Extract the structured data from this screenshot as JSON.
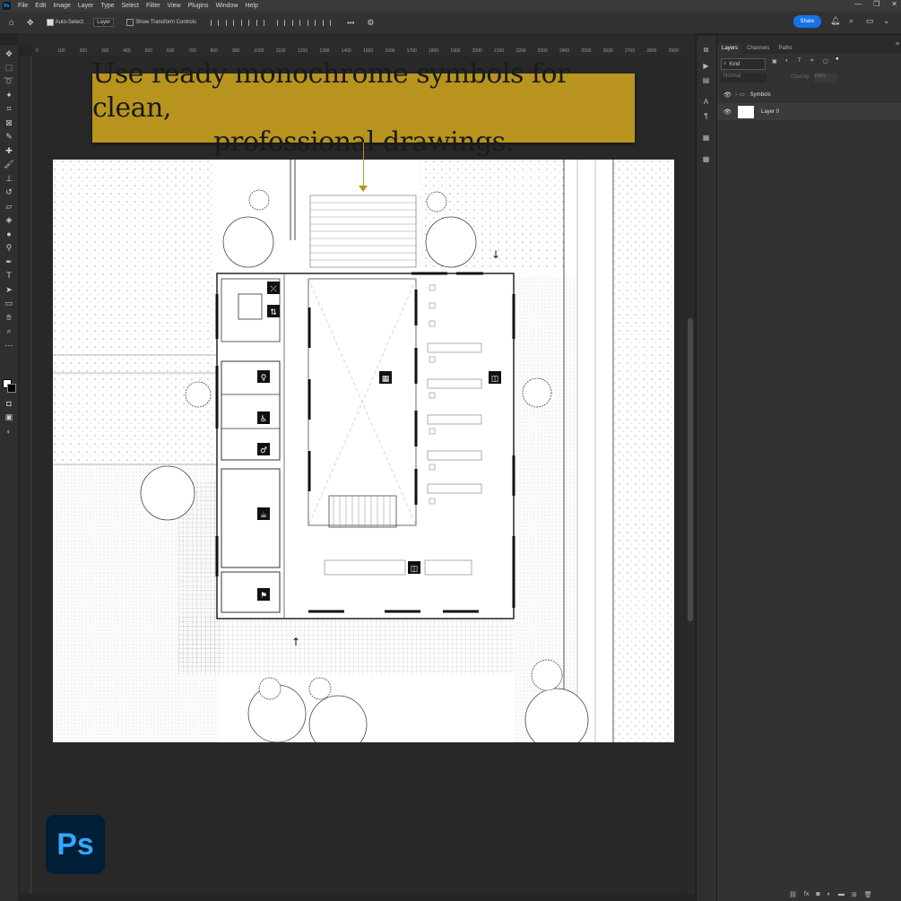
{
  "app": {
    "logo_text": "Ps",
    "mini_logo": "Ps"
  },
  "menu": [
    "File",
    "Edit",
    "Image",
    "Layer",
    "Type",
    "Select",
    "Filter",
    "View",
    "Plugins",
    "Window",
    "Help"
  ],
  "window_controls": [
    "—",
    "❐",
    "✕"
  ],
  "options_bar": {
    "auto_select_label": "Auto-Select:",
    "auto_select_value": "Layer",
    "transform_label": "Show Transform Controls",
    "more": "•••",
    "share_label": "Share"
  },
  "ruler": {
    "ticks": [
      "0",
      "100",
      "200",
      "300",
      "400",
      "500",
      "600",
      "700",
      "800",
      "900",
      "1000",
      "1100",
      "1200",
      "1300",
      "1400",
      "1500",
      "1600",
      "1700",
      "1800",
      "1900",
      "2000",
      "2100",
      "2200",
      "2300",
      "2400",
      "2500",
      "2600",
      "2700",
      "2800",
      "2900"
    ]
  },
  "panel": {
    "tabs": [
      "Layers",
      "Channels",
      "Paths"
    ],
    "filter_label": "Kind",
    "blend_mode": "Normal",
    "opacity_label": "Opacity:",
    "opacity_value": "100%",
    "layers": [
      {
        "name": "Symbols",
        "type": "group"
      },
      {
        "name": "Layer 0",
        "type": "pixel"
      }
    ],
    "bottom_icons": [
      "link-icon",
      "fx-icon",
      "mask-icon",
      "adjustment-icon",
      "folder-icon",
      "new-layer-icon",
      "trash-icon"
    ]
  },
  "banner": {
    "line1": "Use ready monochrome symbols for clean,",
    "line2": "professional drawings."
  },
  "colors": {
    "banner": "#b8941f",
    "share": "#1473e6",
    "ps_blue": "#31a8ff",
    "ps_dark": "#001e36"
  }
}
